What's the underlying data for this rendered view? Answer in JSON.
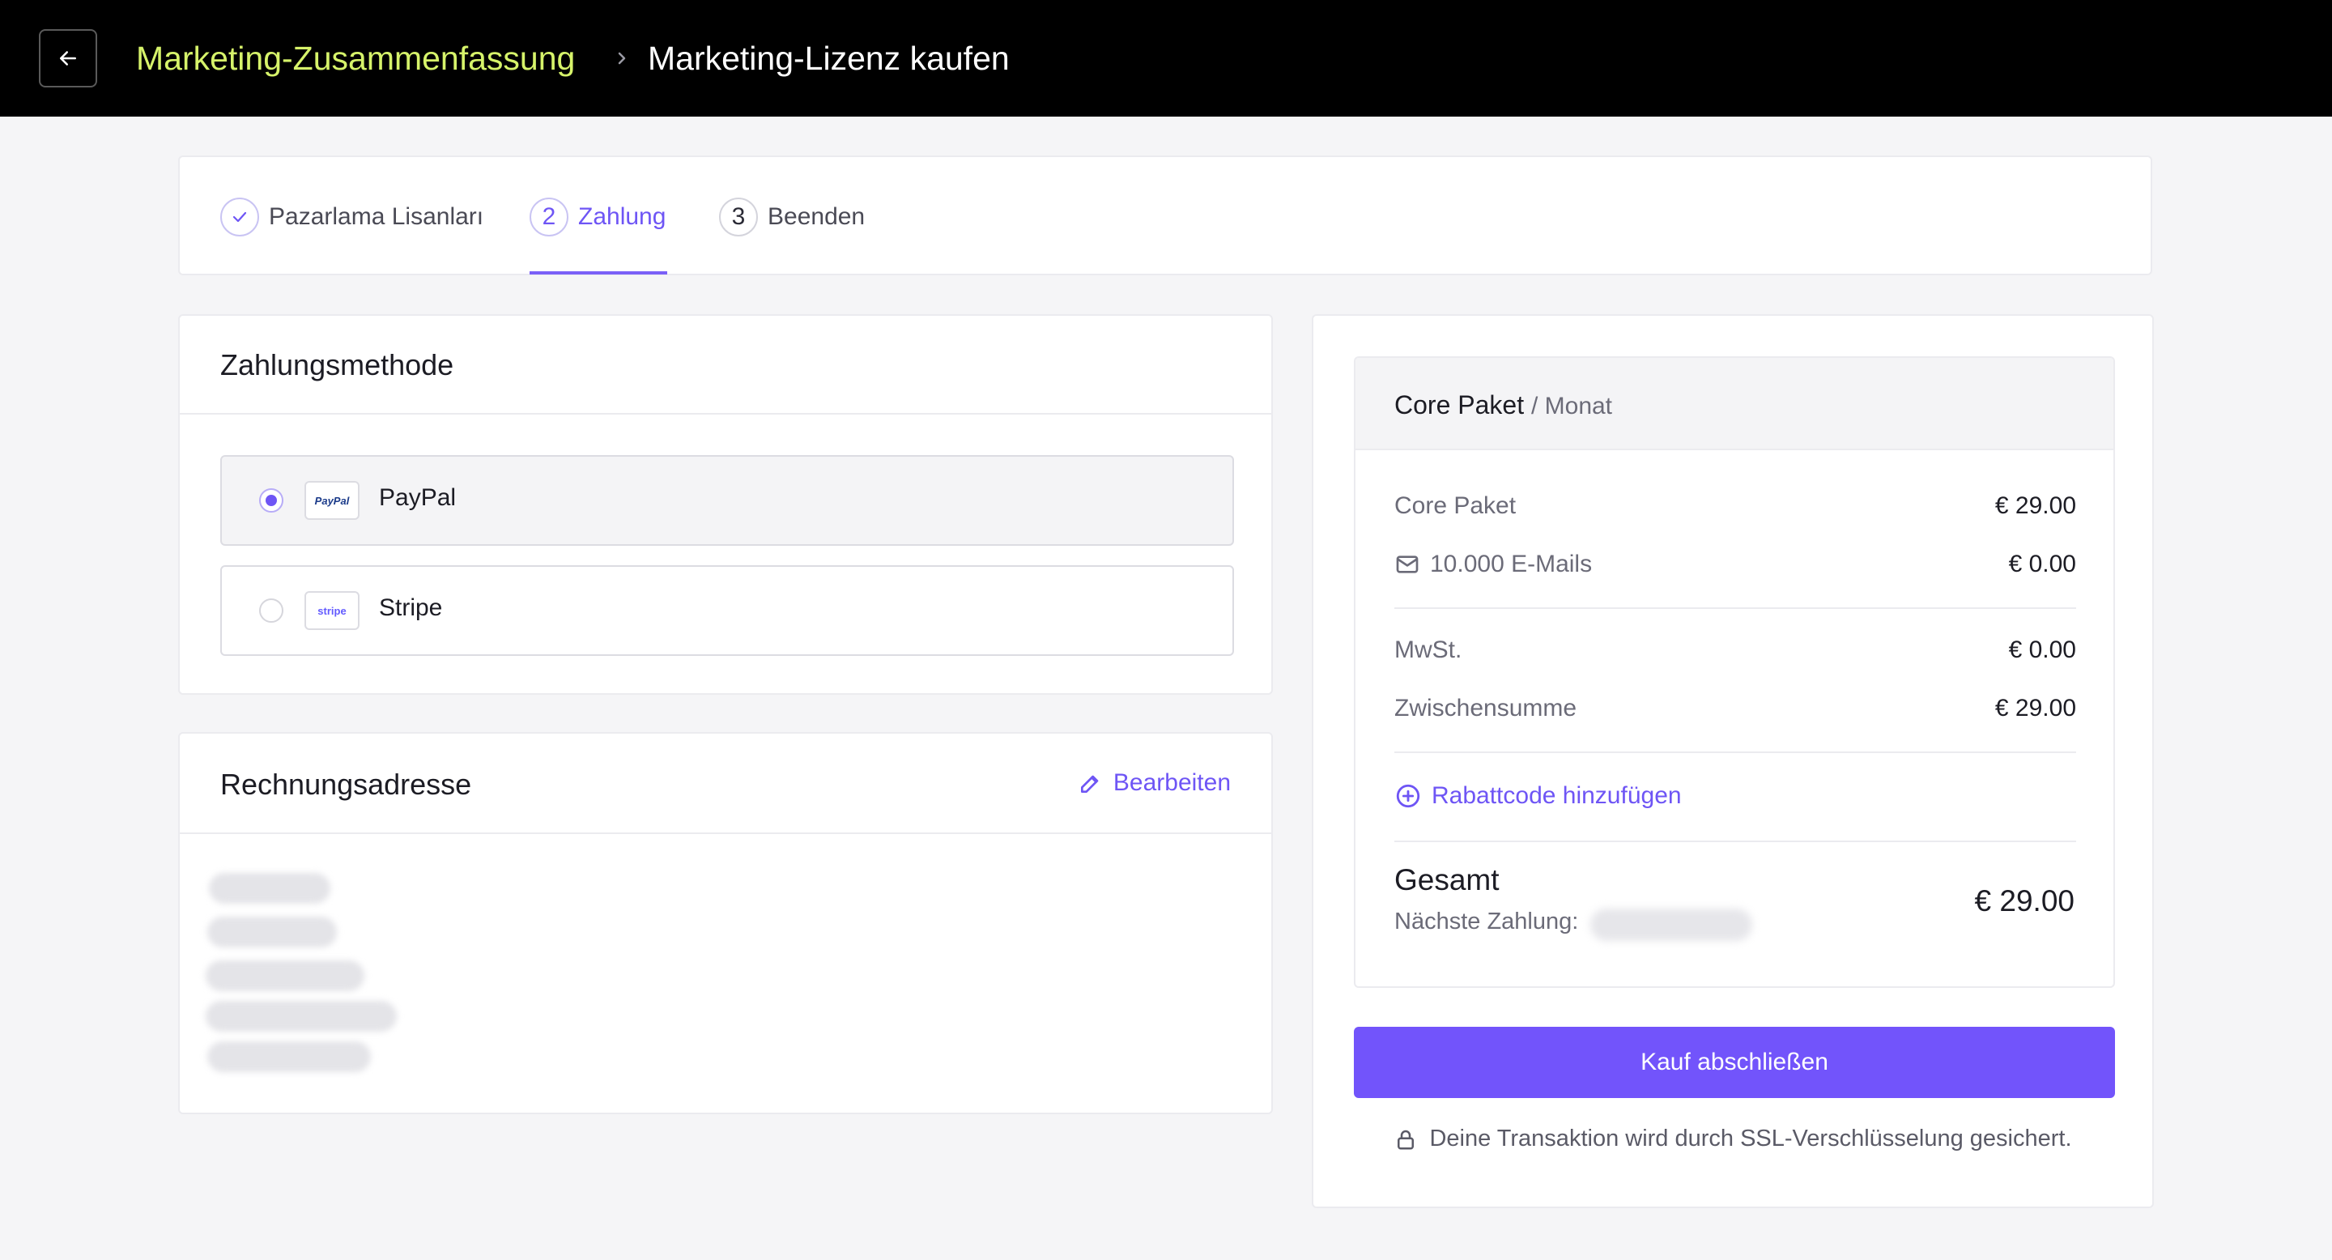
{
  "header": {
    "back_icon": "arrow-left-icon",
    "breadcrumb_link": "Marketing-Zusammenfassung",
    "breadcrumb_sep_icon": "chevron-right-icon",
    "breadcrumb_current": "Marketing-Lizenz kaufen"
  },
  "stepper": {
    "steps": [
      {
        "marker": "check-icon",
        "label": "Pazarlama Lisanları",
        "state": "done"
      },
      {
        "marker": "2",
        "label": "Zahlung",
        "state": "active"
      },
      {
        "marker": "3",
        "label": "Beenden",
        "state": "pending"
      }
    ]
  },
  "payment": {
    "title": "Zahlungsmethode",
    "options": [
      {
        "label": "PayPal",
        "logo": "PayPal",
        "selected": true
      },
      {
        "label": "Stripe",
        "logo": "stripe",
        "selected": false
      }
    ]
  },
  "billing": {
    "title": "Rechnungsadresse",
    "edit_label": "Bearbeiten"
  },
  "summary": {
    "package_name": "Core Paket",
    "package_period": "/ Monat",
    "lines": [
      {
        "label": "Core Paket",
        "value": "€ 29.00"
      },
      {
        "label": "10.000 E-Mails",
        "value": "€ 0.00",
        "icon": "mail-icon"
      }
    ],
    "tax": {
      "label": "MwSt.",
      "value": "€ 0.00"
    },
    "subtotal": {
      "label": "Zwischensumme",
      "value": "€ 29.00"
    },
    "coupon_label": "Rabattcode hinzufügen",
    "total_label": "Gesamt",
    "total_value": "€ 29.00",
    "next_payment_label": "Nächste Zahlung:",
    "buy_button": "Kauf abschließen",
    "ssl_note": "Deine Transaktion wird durch SSL-Verschlüsselung gesichert."
  },
  "colors": {
    "accent": "#7254fb",
    "breadcrumb_link": "#d6f36a",
    "topbar": "#000000"
  }
}
